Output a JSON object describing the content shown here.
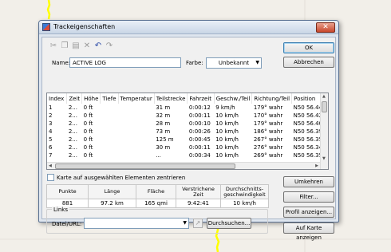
{
  "window": {
    "title": "Trackeigenschaften",
    "close_symbol": "✕"
  },
  "toolbar": {
    "icons": [
      "cut-icon",
      "copy-icon",
      "paste-icon",
      "delete-icon",
      "undo-icon",
      "redo-icon"
    ]
  },
  "name_field": {
    "label": "Name:",
    "value": "ACTIVE LOG"
  },
  "color_field": {
    "label": "Farbe:",
    "value": "Unbekannt"
  },
  "buttons": {
    "ok": "OK",
    "cancel": "Abbrechen",
    "reverse": "Umkehren",
    "filter": "Filter...",
    "show_profile": "Profil anzeigen...",
    "show_on_map": "Auf Karte anzeigen",
    "browse": "Durchsuchen..."
  },
  "table": {
    "columns": [
      "Index",
      "Zeit",
      "Höhe",
      "Tiefe",
      "Temperatur",
      "Teilstrecke",
      "Fahrzeit",
      "Geschw./Teil",
      "Richtung/Teil",
      "Position"
    ],
    "rows": [
      [
        "1",
        "2...",
        "0 ft",
        "",
        "",
        "31 m",
        "0:00:12",
        "9 km/h",
        "179° wahr",
        "N50 56.440"
      ],
      [
        "2",
        "2...",
        "0 ft",
        "",
        "",
        "32 m",
        "0:00:11",
        "10 km/h",
        "170° wahr",
        "N50 56.423"
      ],
      [
        "3",
        "2...",
        "0 ft",
        "",
        "",
        "28 m",
        "0:00:10",
        "10 km/h",
        "179° wahr",
        "N50 56.406"
      ],
      [
        "4",
        "2...",
        "0 ft",
        "",
        "",
        "73 m",
        "0:00:26",
        "10 km/h",
        "186° wahr",
        "N50 56.391"
      ],
      [
        "5",
        "2...",
        "0 ft",
        "",
        "",
        "125 m",
        "0:00:45",
        "10 km/h",
        "267° wahr",
        "N50 56.352"
      ],
      [
        "6",
        "2...",
        "0 ft",
        "",
        "",
        "30 m",
        "0:00:11",
        "10 km/h",
        "276° wahr",
        "N50 56.349"
      ],
      [
        "7",
        "2...",
        "0 ft",
        "",
        "",
        "...",
        "0:00:34",
        "10 km/h",
        "269° wahr",
        "N50 56.351"
      ]
    ]
  },
  "center_checkbox": {
    "label": "Karte auf ausgewählten Elementen zentrieren",
    "checked": false
  },
  "stats": {
    "headers": [
      "Punkte",
      "Länge",
      "Fläche",
      "Verstrichene Zeit",
      "Durchschnitts-geschwindigkeit"
    ],
    "values": [
      "881",
      "97.2 km",
      "165 qmi",
      "9:42:41",
      "10 km/h"
    ]
  },
  "links": {
    "group_label": "Links",
    "file_label": "Datei/URL:",
    "file_value": ""
  },
  "colors": {
    "map_background": "#f2efe9",
    "track": "#ffff00",
    "dialog_frame": "#dfe6ef"
  }
}
